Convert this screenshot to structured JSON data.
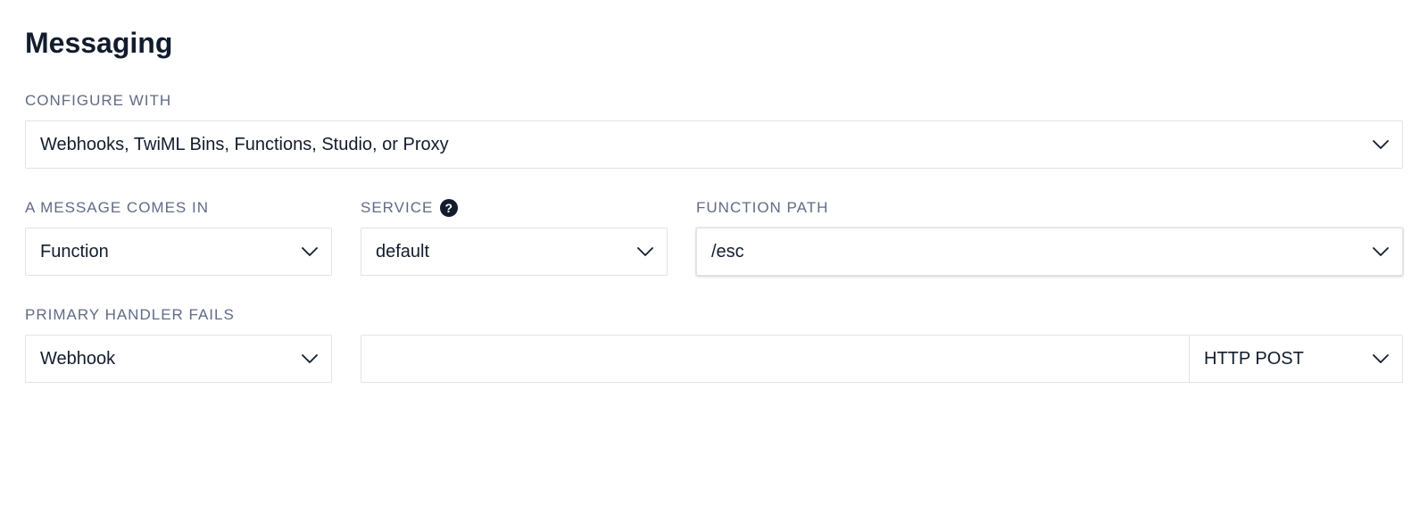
{
  "title": "Messaging",
  "configure_with": {
    "label": "CONFIGURE WITH",
    "value": "Webhooks, TwiML Bins, Functions, Studio, or Proxy"
  },
  "message_comes_in": {
    "label": "A MESSAGE COMES IN",
    "value": "Function"
  },
  "service": {
    "label": "SERVICE",
    "value": "default"
  },
  "function_path": {
    "label": "FUNCTION PATH",
    "value": "/esc"
  },
  "primary_handler_fails": {
    "label": "PRIMARY HANDLER FAILS",
    "value": "Webhook"
  },
  "fallback_url": {
    "value": ""
  },
  "fallback_method": {
    "value": "HTTP POST"
  }
}
